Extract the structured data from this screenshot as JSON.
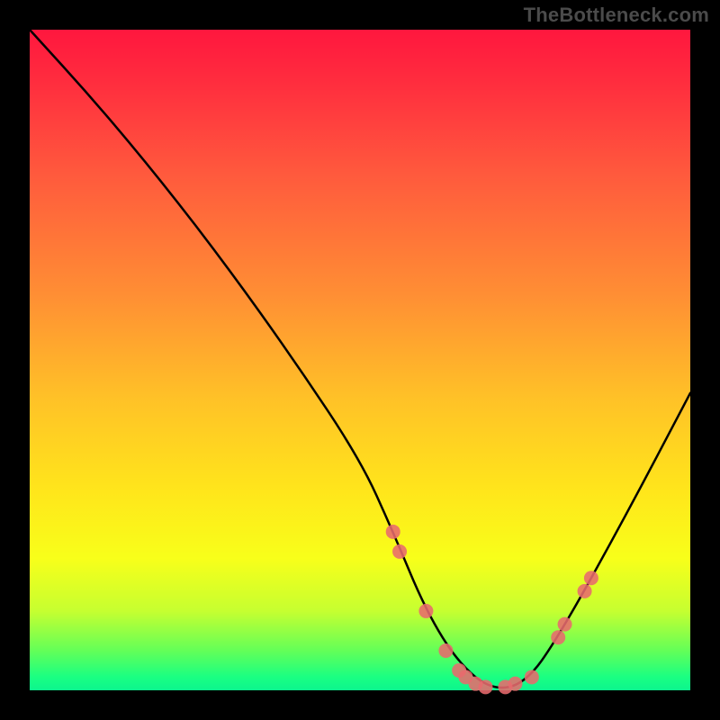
{
  "branding": "TheBottleneck.com",
  "chart_data": {
    "type": "line",
    "title": "",
    "xlabel": "",
    "ylabel": "",
    "xlim": [
      0,
      100
    ],
    "ylim": [
      0,
      100
    ],
    "series": [
      {
        "name": "bottleneck-curve",
        "x": [
          0,
          10,
          20,
          30,
          40,
          50,
          55,
          60,
          65,
          70,
          75,
          80,
          90,
          100
        ],
        "y": [
          100,
          89,
          77,
          64,
          50,
          35,
          24,
          12,
          4,
          0,
          1,
          8,
          26,
          45
        ]
      }
    ],
    "markers": [
      {
        "x": 55,
        "y": 24
      },
      {
        "x": 56,
        "y": 21
      },
      {
        "x": 60,
        "y": 12
      },
      {
        "x": 63,
        "y": 6
      },
      {
        "x": 65,
        "y": 3
      },
      {
        "x": 66,
        "y": 2
      },
      {
        "x": 67.5,
        "y": 1
      },
      {
        "x": 69,
        "y": 0.5
      },
      {
        "x": 72,
        "y": 0.5
      },
      {
        "x": 73.5,
        "y": 1
      },
      {
        "x": 76,
        "y": 2
      },
      {
        "x": 80,
        "y": 8
      },
      {
        "x": 81,
        "y": 10
      },
      {
        "x": 84,
        "y": 15
      },
      {
        "x": 85,
        "y": 17
      }
    ],
    "gradient_stops": [
      {
        "pct": 0,
        "color": "#ff173e"
      },
      {
        "pct": 22,
        "color": "#ff5a3d"
      },
      {
        "pct": 56,
        "color": "#ffc227"
      },
      {
        "pct": 80,
        "color": "#f8ff1a"
      },
      {
        "pct": 94,
        "color": "#63ff58"
      },
      {
        "pct": 100,
        "color": "#0cf58e"
      }
    ],
    "marker_color": "#e86a6d",
    "curve_color": "#000000"
  }
}
